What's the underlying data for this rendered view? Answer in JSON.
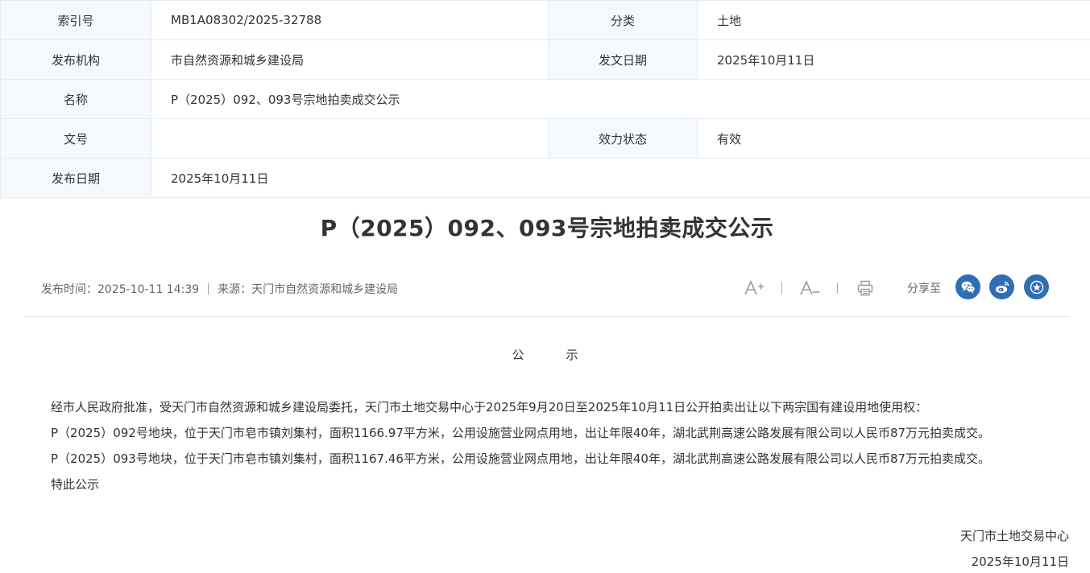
{
  "info": {
    "index_label": "索引号",
    "index_value": "MB1A08302/2025-32788",
    "category_label": "分类",
    "category_value": "土地",
    "org_label": "发布机构",
    "org_value": "市自然资源和城乡建设局",
    "issue_date_label": "发文日期",
    "issue_date_value": "2025年10月11日",
    "name_label": "名称",
    "name_value": "P（2025）092、093号宗地拍卖成交公示",
    "doc_no_label": "文号",
    "doc_no_value": "",
    "status_label": "效力状态",
    "status_value": "有效",
    "publish_date_label": "发布日期",
    "publish_date_value": "2025年10月11日"
  },
  "article": {
    "title": "P（2025）092、093号宗地拍卖成交公示",
    "publish_time": "发布时间：2025-10-11 14:39",
    "source": "来源：天门市自然资源和城乡建设局",
    "heading_1": "公",
    "heading_2": "示",
    "paragraphs": [
      "经市人民政府批准，受天门市自然资源和城乡建设局委托，天门市土地交易中心于2025年9月20日至2025年10月11日公开拍卖出让以下两宗国有建设用地使用权：",
      "P（2025）092号地块，位于天门市皂市镇刘集村，面积1166.97平方米，公用设施营业网点用地，出让年限40年，湖北武荆高速公路发展有限公司以人民币87万元拍卖成交。",
      "P（2025）093号地块，位于天门市皂市镇刘集村，面积1167.46平方米，公用设施营业网点用地，出让年限40年，湖北武荆高速公路发展有限公司以人民币87万元拍卖成交。",
      "特此公示"
    ],
    "signature_org": "天门市土地交易中心",
    "signature_date": "2025年10月11日"
  },
  "tools": {
    "share_label": "分享至",
    "font_increase_icon": "font-increase-icon",
    "font_decrease_icon": "font-decrease-icon",
    "print_icon": "print-icon",
    "wechat_icon": "wechat-icon",
    "weibo_icon": "weibo-icon",
    "favorite_icon": "star-icon"
  },
  "colors": {
    "label_bg": "#f5f9fd",
    "border": "#e4ebf3",
    "share_blue": "#2f6db5"
  }
}
